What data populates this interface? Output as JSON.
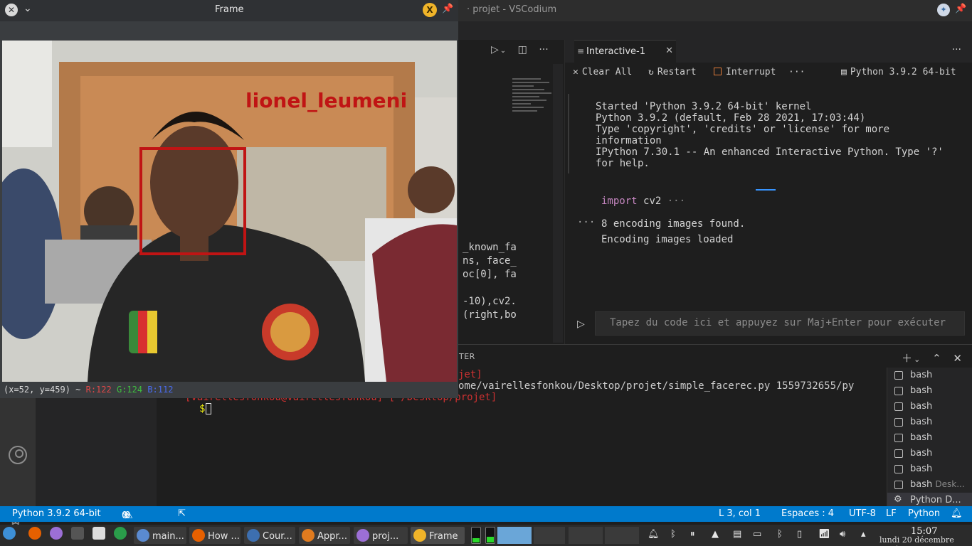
{
  "vscode": {
    "title": "· projet - VSCodium",
    "editor_code": [
      "_known_fa",
      "ns, face_",
      "oc[0], fa",
      "-10),cv2.",
      "(right,bo"
    ],
    "interactive": {
      "tab_label": "Interactive-1",
      "actions": {
        "clear_all": "Clear All",
        "restart": "Restart",
        "interrupt": "Interrupt",
        "more": "···",
        "kernel": "Python 3.9.2 64-bit"
      },
      "output_text": "Started 'Python 3.9.2 64-bit' kernel\nPython 3.9.2 (default, Feb 28 2021, 17:03:44)\nType 'copyright', 'credits' or 'license' for more\ninformation\nIPython 7.30.1 -- An enhanced Interactive Python. Type '?'\nfor help.",
      "cell_keyword": "import",
      "cell_module": "cv2",
      "cell_ellipsis": "···",
      "cell_output": [
        "8 encoding images found.",
        "Encoding images loaded"
      ],
      "input_placeholder": "Tapez du code ici et appuyez sur Maj+Enter pour exécuter"
    },
    "terminal": {
      "tabs_label": "TER",
      "lines": [
        {
          "text": "jet]",
          "color": "#cd3131"
        },
        {
          "text": "ome/vairellesfonkou/Desktop/projet/simple_facerec.py 1559732655/py",
          "color": "#cccccc"
        },
        {
          "text": "[vairellesfonkou@vairellesfonkou] [~/Desktop/projet]",
          "color": "#cd3131"
        },
        {
          "text": "$",
          "color": "#e5e510"
        }
      ],
      "list": [
        {
          "name": "bash",
          "desc": ""
        },
        {
          "name": "bash",
          "desc": ""
        },
        {
          "name": "bash",
          "desc": ""
        },
        {
          "name": "bash",
          "desc": ""
        },
        {
          "name": "bash",
          "desc": ""
        },
        {
          "name": "bash",
          "desc": ""
        },
        {
          "name": "bash",
          "desc": ""
        },
        {
          "name": "bash",
          "desc": "Desk..."
        },
        {
          "name": "Python D...",
          "desc": ""
        }
      ]
    },
    "statusbar": {
      "interpreter": "Python 3.9.2 64-bit",
      "errors": "0",
      "warnings": "0",
      "position": "L 3, col 1",
      "spaces": "Espaces : 4",
      "encoding": "UTF-8",
      "eol": "LF",
      "language": "Python"
    },
    "settings_badge": "1"
  },
  "frame_window": {
    "title": "Frame",
    "face_label": "lionel_leumeni",
    "status_coords": "(x=52, y=459) ~",
    "status_r": "R:122",
    "status_g": "G:124",
    "status_b": "B:112"
  },
  "taskbar": {
    "items": [
      {
        "label": "main...",
        "color": "#5a8ad0"
      },
      {
        "label": "How ...",
        "color": "#e66000"
      },
      {
        "label": "Cour...",
        "color": "#3d6fb0"
      },
      {
        "label": "Appr...",
        "color": "#e07b1f"
      },
      {
        "label": "proj...",
        "color": "#9c6fd6"
      },
      {
        "label": "Frame",
        "color": "#f0b429"
      }
    ],
    "time": "15:07",
    "date": "lundi 20 décembre 2021"
  }
}
